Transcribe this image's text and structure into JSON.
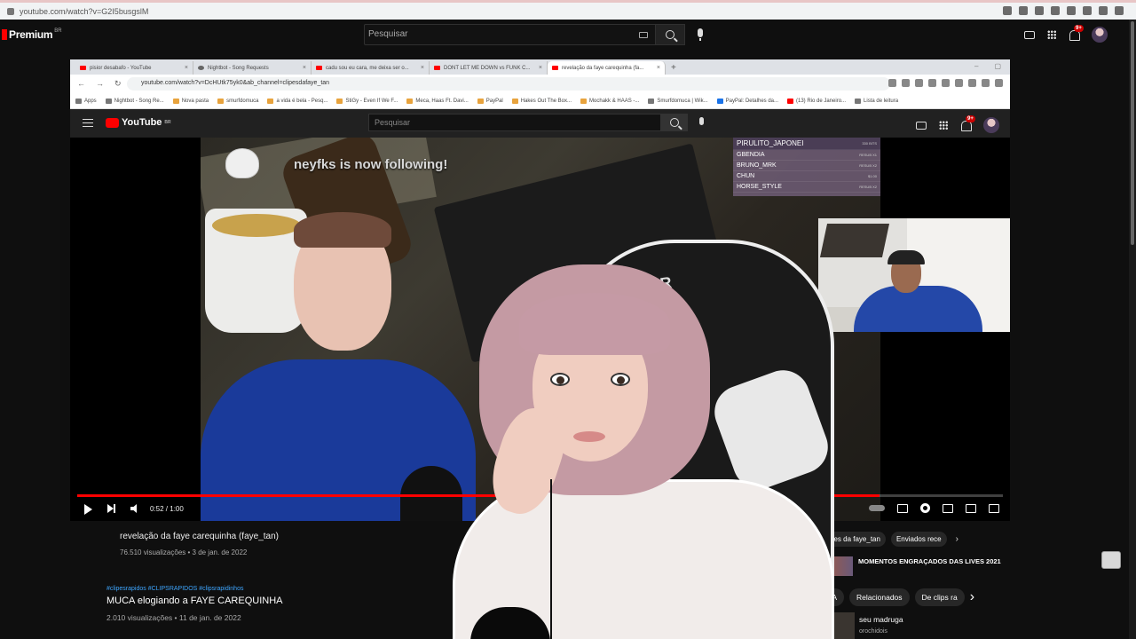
{
  "outer_browser": {
    "url": "youtube.com/watch?v=G2I5busgslM"
  },
  "outer_header": {
    "logo_text": "Premium",
    "logo_country": "BR",
    "search_placeholder": "Pesquisar",
    "notif_badge": "9+"
  },
  "inner_browser": {
    "tabs": [
      {
        "label": "pisior desabafo - YouTube",
        "icon": "youtube-favicon"
      },
      {
        "label": "Nightbot - Song Requests",
        "icon": "nightbot-favicon"
      },
      {
        "label": "cadu sou eu cara, me deixa ser o...",
        "icon": "youtube-favicon"
      },
      {
        "label": "DONT LET ME DOWN vs FUNK C...",
        "icon": "youtube-favicon"
      },
      {
        "label": "revelação da faye carequinha (fa...",
        "icon": "youtube-favicon",
        "active": true
      }
    ],
    "url": "youtube.com/watch?v=DcHUtk75yk0&ab_channel=clipesdafaye_tan",
    "bookmarks": [
      {
        "label": "Apps",
        "icon": "grey"
      },
      {
        "label": "Nightbot - Song Re...",
        "icon": "grey"
      },
      {
        "label": "Nova pasta",
        "icon": "folder"
      },
      {
        "label": "smurfdomuca",
        "icon": "folder"
      },
      {
        "label": "a vida é bela - Pesq...",
        "icon": "folder"
      },
      {
        "label": "StiGy - Even If We F...",
        "icon": "folder"
      },
      {
        "label": "Meca, Haas Ft. Davi...",
        "icon": "folder"
      },
      {
        "label": "PayPal",
        "icon": "folder"
      },
      {
        "label": "Hakes Out The Box...",
        "icon": "folder"
      },
      {
        "label": "Mochakk & HAAS -...",
        "icon": "folder"
      },
      {
        "label": "Smurfdomuca | Wik...",
        "icon": "grey"
      },
      {
        "label": "PayPal: Detalhes da...",
        "icon": "blue"
      },
      {
        "label": "(13) Rio de Janeiro...",
        "icon": "red"
      },
      {
        "label": "Lista de leitura",
        "icon": "grey"
      }
    ],
    "yt_logo": "YouTube",
    "yt_country": "BR",
    "search_placeholder": "Pesquisar",
    "notif_badge": "9+"
  },
  "video": {
    "follow_alert": "neyfks is now following!",
    "current_time": "0:52 / 1:00",
    "progress_fraction": 0.867,
    "leaderboard": [
      {
        "name": "PIRULITO_JAPONEI",
        "pts": "330 BITS"
      },
      {
        "name": "GBENDIA",
        "pts": "RESUB X1"
      },
      {
        "name": "BRUNO_MRK",
        "pts": "RESUB X2"
      },
      {
        "name": "CHUN",
        "pts": "$1.00"
      },
      {
        "name": "HORSE_STYLE",
        "pts": "RESUB X2"
      }
    ]
  },
  "inner_below": {
    "title": "revelação da faye carequinha (faye_tan)",
    "meta": "76.510 visualizações • 3 de jan. de 2022",
    "chips": [
      "De clipes da faye_tan",
      "Enviados rece"
    ],
    "rec_title": "MOMENTOS ENGRAÇADOS DAS LIVES 2021"
  },
  "outer_below": {
    "tags": "#clipesrapidos #CLIPSRAPIDOS #clipsrapidinhos",
    "title": "MUCA elogiando a FAYE CAREQUINHA",
    "meta": "2.010 visualizações • 11 de jan. de 2022",
    "chips": [
      "MOBA",
      "Relacionados",
      "De clips ra"
    ],
    "rec_title": "seu madruga",
    "rec_channel": "orochidois"
  },
  "overlay": {
    "chair_logo": "X PER"
  }
}
